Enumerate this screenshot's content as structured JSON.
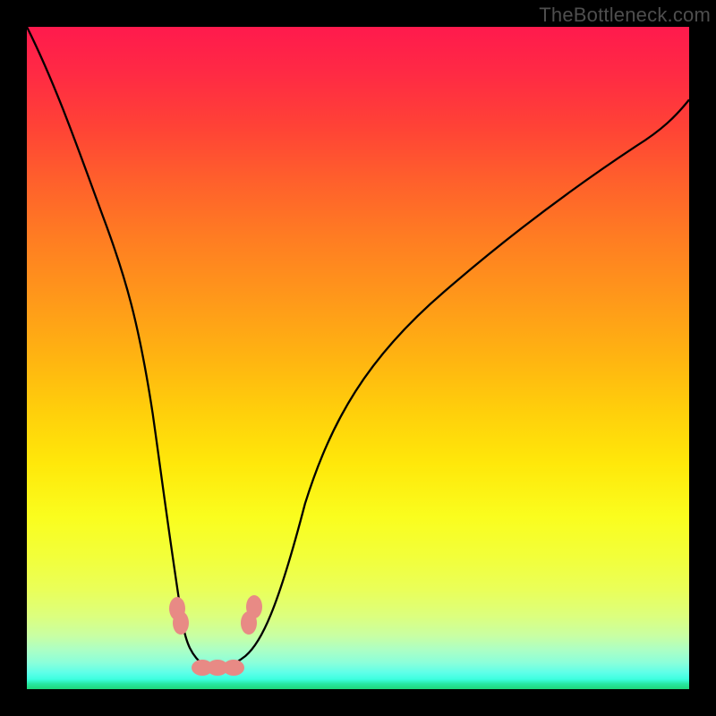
{
  "watermark": "TheBottleneck.com",
  "colors": {
    "frame": "#000000",
    "gradient_top": "#ff1a4d",
    "gradient_bottom": "#1fd67a",
    "curve": "#000000",
    "bead": "#e88a85"
  },
  "chart_data": {
    "type": "line",
    "title": "",
    "xlabel": "",
    "ylabel": "",
    "xlim": [
      0,
      100
    ],
    "ylim": [
      0,
      100
    ],
    "series": [
      {
        "name": "bottleneck-curve",
        "x": [
          0,
          4,
          8,
          12,
          16,
          19,
          21,
          23.5,
          25.5,
          27,
          30,
          33,
          37,
          42,
          48,
          55,
          63,
          72,
          82,
          92,
          100
        ],
        "values": [
          100,
          87,
          74,
          60,
          46,
          32,
          20,
          10,
          4.5,
          3.3,
          3.3,
          5,
          10,
          18,
          28,
          39,
          50,
          61,
          72,
          82,
          89
        ]
      }
    ],
    "annotations": {
      "min_region_x": [
        24.5,
        32
      ],
      "min_region_y": 3.3,
      "beads_left_branch_y": [
        10,
        12.2
      ],
      "beads_right_branch_y": [
        10,
        12.8
      ],
      "beads_bottom_x": [
        26.5,
        28.8,
        31.2
      ],
      "beads_bottom_y": 3.3
    }
  }
}
